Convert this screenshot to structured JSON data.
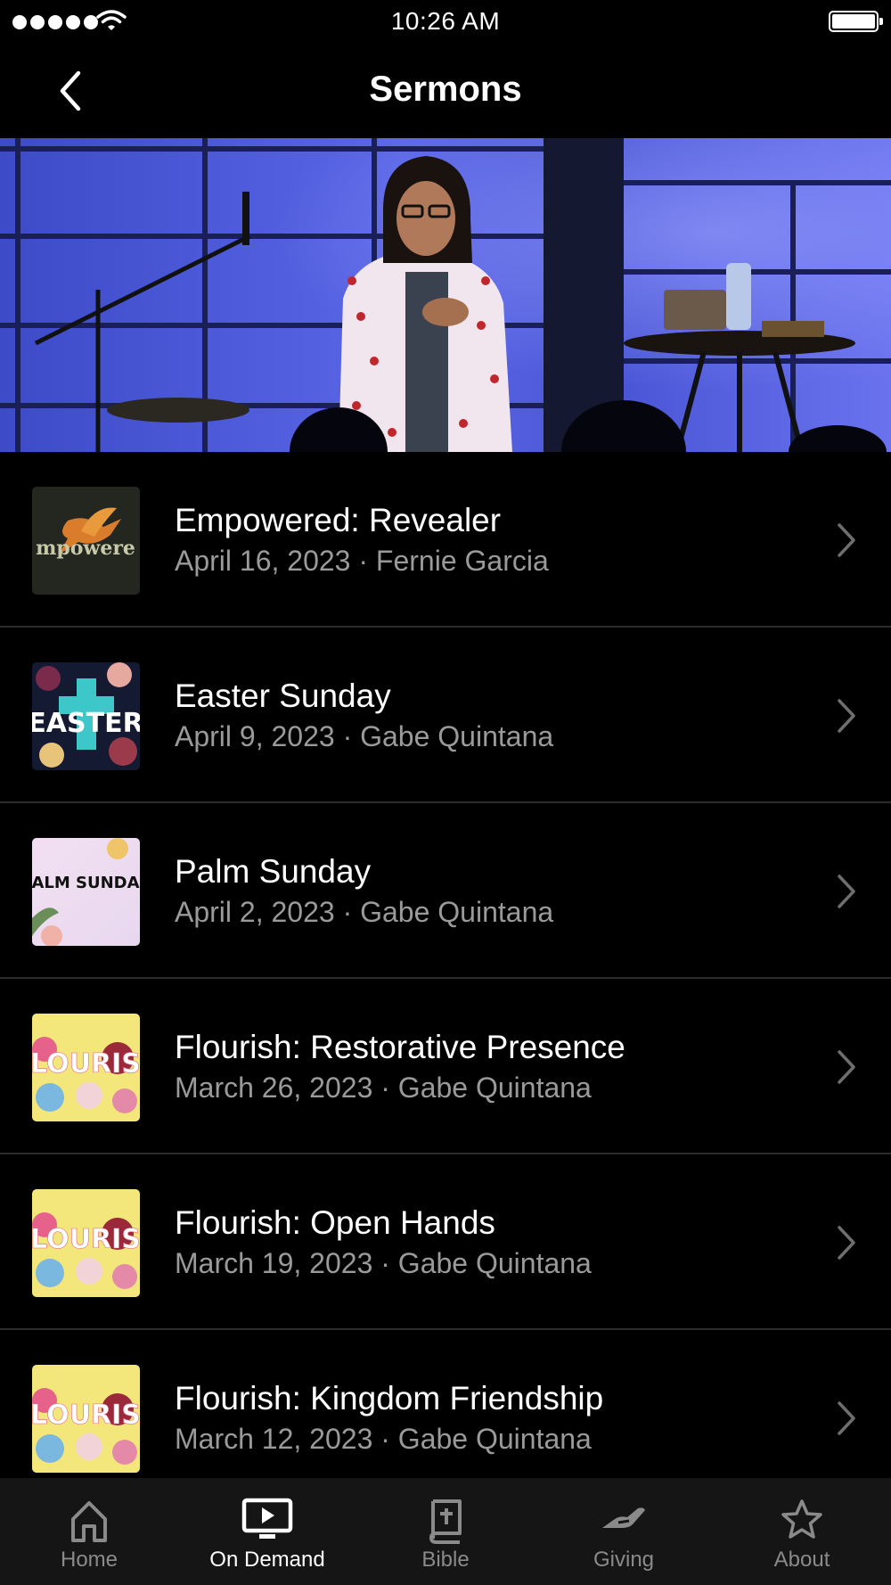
{
  "status_bar": {
    "time": "10:26 AM"
  },
  "nav": {
    "title": "Sermons"
  },
  "sermons": [
    {
      "title": "Empowered: Revealer",
      "subtitle": "April 16, 2023 · Fernie Garcia",
      "thumb_text": "mpowere"
    },
    {
      "title": "Easter Sunday",
      "subtitle": "April 9, 2023 · Gabe Quintana",
      "thumb_text": "EASTER"
    },
    {
      "title": "Palm Sunday",
      "subtitle": "April 2, 2023 · Gabe Quintana",
      "thumb_text": "ALM SUNDA"
    },
    {
      "title": "Flourish: Restorative Presence",
      "subtitle": "March 26, 2023 · Gabe Quintana",
      "thumb_text": "LOURIS"
    },
    {
      "title": "Flourish: Open Hands",
      "subtitle": "March 19, 2023 · Gabe Quintana",
      "thumb_text": "LOURIS"
    },
    {
      "title": "Flourish: Kingdom Friendship",
      "subtitle": "March 12, 2023 · Gabe Quintana",
      "thumb_text": "LOURIS"
    }
  ],
  "tabs": [
    {
      "label": "Home",
      "icon": "home-icon"
    },
    {
      "label": "On Demand",
      "icon": "play-screen-icon",
      "active": true
    },
    {
      "label": "Bible",
      "icon": "bible-icon"
    },
    {
      "label": "Giving",
      "icon": "giving-hand-icon"
    },
    {
      "label": "About",
      "icon": "star-icon"
    }
  ],
  "colors": {
    "background": "#000000",
    "subtitle": "#9a9a9a",
    "tab_bar": "#151515",
    "divider": "#2b2b2b"
  }
}
